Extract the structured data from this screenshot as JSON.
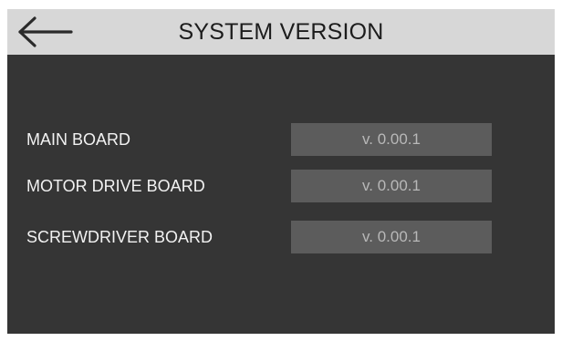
{
  "header": {
    "title": "SYSTEM VERSION",
    "back_icon": "back-arrow-icon"
  },
  "versions": [
    {
      "label": "MAIN BOARD",
      "value": "v. 0.00.1"
    },
    {
      "label": "MOTOR DRIVE BOARD",
      "value": "v. 0.00.1"
    },
    {
      "label": "SCREWDRIVER BOARD",
      "value": "v. 0.00.1"
    }
  ],
  "colors": {
    "screen_background": "#353535",
    "header_background": "#d7d7d7",
    "value_field_background": "#5c5c5c",
    "value_text": "#b8b8b8",
    "label_text": "#f2f2f2"
  }
}
